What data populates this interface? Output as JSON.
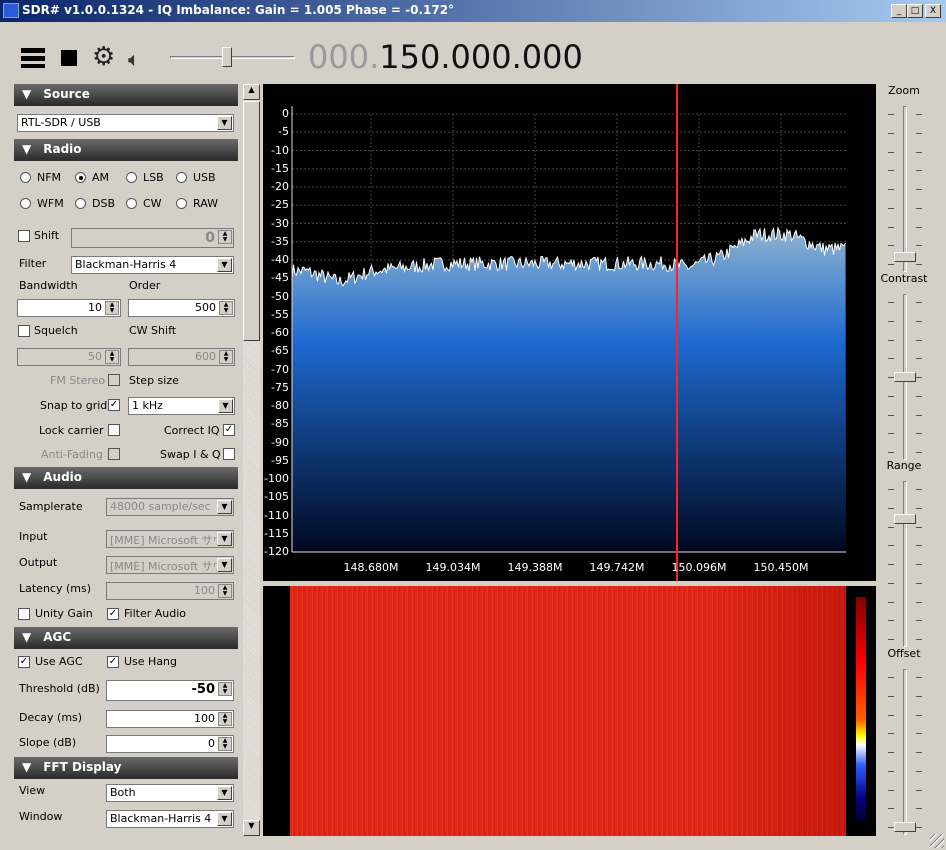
{
  "window": {
    "title": "SDR# v1.0.0.1324 - IQ Imbalance: Gain = 1.005 Phase = -0.172°",
    "minimize": "_",
    "maximize": "□",
    "close": "X"
  },
  "toolbar": {
    "frequency_prefix": "000.",
    "frequency": "150.000.000",
    "volume_level": 0.45,
    "icons": [
      "menu-icon",
      "stop-icon",
      "gear-icon",
      "speaker-icon"
    ]
  },
  "source": {
    "title": "Source",
    "device": "RTL-SDR / USB"
  },
  "radio": {
    "title": "Radio",
    "modes": [
      "NFM",
      "AM",
      "LSB",
      "USB",
      "WFM",
      "DSB",
      "CW",
      "RAW"
    ],
    "selected_mode": "AM",
    "shift_label": "Shift",
    "shift_value": "0",
    "filter_label": "Filter",
    "filter_value": "Blackman-Harris 4",
    "bandwidth_label": "Bandwidth",
    "bandwidth_value": "10",
    "order_label": "Order",
    "order_value": "500",
    "squelch_label": "Squelch",
    "squelch_value": "50",
    "cwshift_label": "CW Shift",
    "cwshift_value": "600",
    "fm_stereo_label": "FM Stereo",
    "step_size_label": "Step size",
    "snap_label": "Snap to grid",
    "step_value": "1 kHz",
    "lock_carrier_label": "Lock carrier",
    "correct_iq_label": "Correct IQ",
    "anti_fading_label": "Anti-Fading",
    "swap_iq_label": "Swap I & Q"
  },
  "audio": {
    "title": "Audio",
    "samplerate_label": "Samplerate",
    "samplerate_value": "48000 sample/sec",
    "input_label": "Input",
    "input_value": "[MME] Microsoft サウ",
    "output_label": "Output",
    "output_value": "[MME] Microsoft サウ",
    "latency_label": "Latency (ms)",
    "latency_value": "100",
    "unity_gain_label": "Unity Gain",
    "filter_audio_label": "Filter Audio"
  },
  "agc": {
    "title": "AGC",
    "use_agc_label": "Use AGC",
    "use_hang_label": "Use Hang",
    "threshold_label": "Threshold (dB)",
    "threshold_value": "-50",
    "decay_label": "Decay (ms)",
    "decay_value": "100",
    "slope_label": "Slope (dB)",
    "slope_value": "0"
  },
  "fft": {
    "title": "FFT Display",
    "view_label": "View",
    "view_value": "Both",
    "window_label": "Window",
    "window_value": "Blackman-Harris 4"
  },
  "right": {
    "zoom_label": "Zoom",
    "contrast_label": "Contrast",
    "range_label": "Range",
    "offset_label": "Offset",
    "zoom_level": 0.05,
    "contrast_level": 0.5,
    "range_level": 0.8,
    "offset_level": 0.0
  },
  "colors": {
    "spectrum_top": "#8fb4d0",
    "spectrum_mid": "#1e6ad0",
    "spectrum_bottom": "#000820",
    "center_line": "#ff2020",
    "waterfall": "#e8281a"
  },
  "chart_data": {
    "type": "area",
    "ylim": [
      -120,
      0
    ],
    "y_ticks": [
      "0",
      "-5",
      "-10",
      "-15",
      "-20",
      "-25",
      "-30",
      "-35",
      "-40",
      "-45",
      "-50",
      "-55",
      "-60",
      "-65",
      "-70",
      "-75",
      "-80",
      "-85",
      "-90",
      "-95",
      "-100",
      "-105",
      "-110",
      "-115",
      "-120"
    ],
    "x_ticks": [
      "148.680M",
      "149.034M",
      "149.388M",
      "149.742M",
      "150.096M",
      "150.450M"
    ],
    "center_frequency": "150.000M",
    "trace_x_mhz": [
      148.4,
      148.55,
      148.7,
      149.0,
      149.4,
      149.8,
      150.0,
      150.1,
      150.25,
      150.4,
      150.55,
      150.7
    ],
    "trace_db": [
      -43,
      -46,
      -43,
      -41,
      -41,
      -41,
      -41,
      -42,
      -39,
      -33,
      -33,
      -37
    ]
  }
}
